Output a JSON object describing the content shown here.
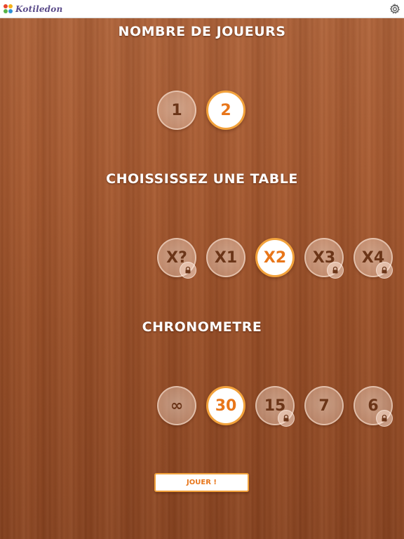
{
  "header": {
    "logo_text": "Kotiledon",
    "settings_icon": "gear-icon"
  },
  "players": {
    "title": "NOMBRE DE JOUEURS",
    "options": [
      {
        "label": "1",
        "selected": false,
        "locked": false
      },
      {
        "label": "2",
        "selected": true,
        "locked": false
      }
    ]
  },
  "table": {
    "title": "CHOISSISSEZ UNE TABLE",
    "options": [
      {
        "label": "X?",
        "selected": false,
        "locked": true
      },
      {
        "label": "X1",
        "selected": false,
        "locked": false
      },
      {
        "label": "X2",
        "selected": true,
        "locked": false
      },
      {
        "label": "X3",
        "selected": false,
        "locked": true
      },
      {
        "label": "X4",
        "selected": false,
        "locked": true
      }
    ]
  },
  "timer": {
    "title": "CHRONOMETRE",
    "options": [
      {
        "label": "∞",
        "selected": false,
        "locked": false
      },
      {
        "label": "30",
        "selected": true,
        "locked": false
      },
      {
        "label": "15",
        "selected": false,
        "locked": true
      },
      {
        "label": "7",
        "selected": false,
        "locked": false
      },
      {
        "label": "6",
        "selected": false,
        "locked": true
      }
    ]
  },
  "play_button": {
    "label": "JOUER !"
  },
  "colors": {
    "accent": "#f2a23c",
    "selected_text": "#e8761a",
    "unselected_text": "#6b3518",
    "wood": "#a85a30"
  }
}
